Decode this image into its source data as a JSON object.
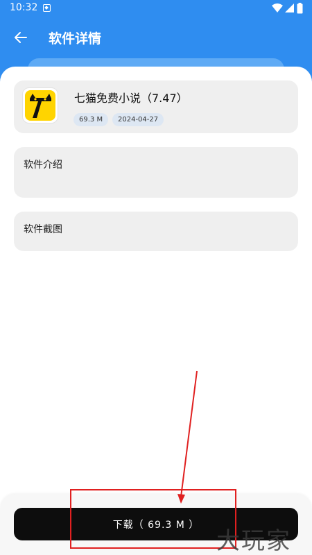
{
  "status_bar": {
    "time": "10:32",
    "icons": [
      "app-notification-icon",
      "wifi-icon",
      "signal-icon",
      "battery-icon"
    ]
  },
  "app_bar": {
    "back_icon": "arrow-left-icon",
    "title": "软件详情"
  },
  "app": {
    "name": "七猫免费小说（7.47）",
    "size": "69.3 M",
    "date": "2024-04-27",
    "logo_icon": "seven-cat-logo",
    "logo_color": "#ffd400"
  },
  "sections": {
    "intro_title": "软件介绍",
    "screenshots_title": "软件截图"
  },
  "download": {
    "label": "下载（ 69.3 M ）"
  },
  "annotation": {
    "color": "#e02020"
  },
  "watermark": {
    "text": "大玩家"
  },
  "colors": {
    "primary": "#2f8df0",
    "button": "#0d0d0d",
    "card": "#efefef",
    "tag": "#dde7f3"
  }
}
